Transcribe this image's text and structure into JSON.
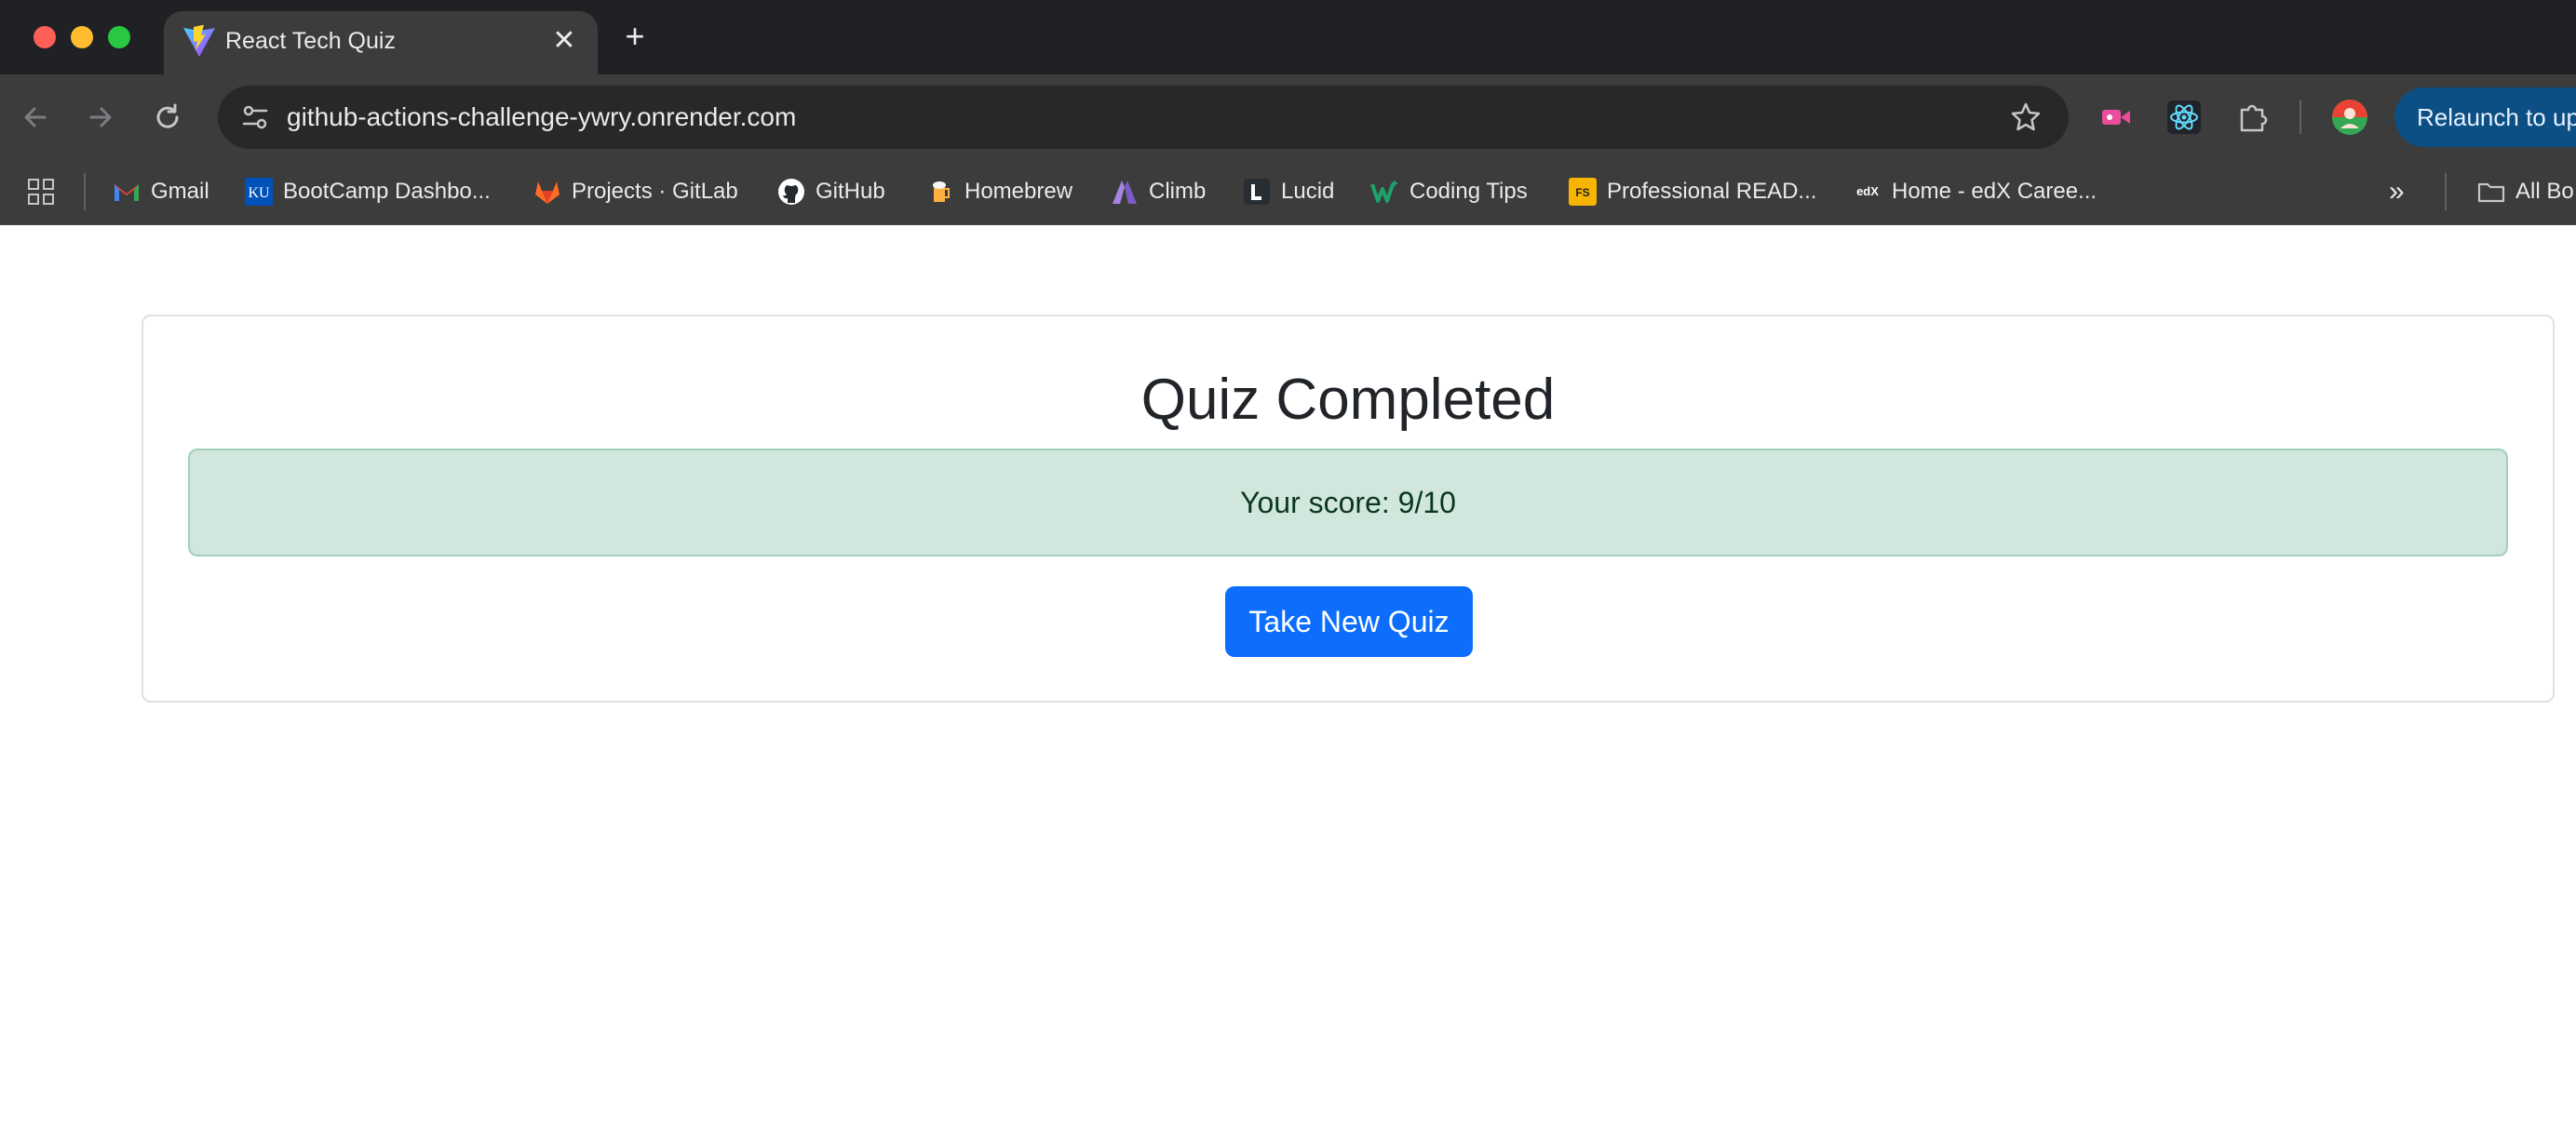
{
  "browser": {
    "tab": {
      "title": "React Tech Quiz",
      "close_glyph": "✕"
    },
    "new_tab_glyph": "+",
    "address": {
      "url": "github-actions-challenge-ywry.onrender.com"
    },
    "relaunch_label": "Relaunch to up",
    "bookmarks": [
      {
        "label": "Gmail",
        "icon": "gmail-icon"
      },
      {
        "label": "BootCamp Dashbo...",
        "icon": "ku-icon"
      },
      {
        "label": "Projects · GitLab",
        "icon": "gitlab-icon"
      },
      {
        "label": "GitHub",
        "icon": "github-icon"
      },
      {
        "label": "Homebrew",
        "icon": "homebrew-icon"
      },
      {
        "label": "Climb",
        "icon": "climb-icon"
      },
      {
        "label": "Lucid",
        "icon": "lucid-icon"
      },
      {
        "label": "Coding Tips",
        "icon": "coding-tips-icon"
      },
      {
        "label": "Professional READ...",
        "icon": "fs-icon"
      },
      {
        "label": "Home - edX Caree...",
        "icon": "edx-icon"
      }
    ],
    "all_bookmarks_label": "All Bo",
    "more_glyph": "»",
    "icon_badges": {
      "ku": "KU",
      "fs": "FS",
      "edx": "edX"
    }
  },
  "quiz": {
    "title": "Quiz Completed",
    "score_text": "Your score: 9/10",
    "new_quiz_label": "Take New Quiz"
  },
  "colors": {
    "accent": "#0d6efd",
    "success_bg": "#d1e7dd",
    "success_border": "#a3cfbb",
    "chrome_dark": "#202124",
    "chrome_toolbar": "#3c3c3c"
  }
}
